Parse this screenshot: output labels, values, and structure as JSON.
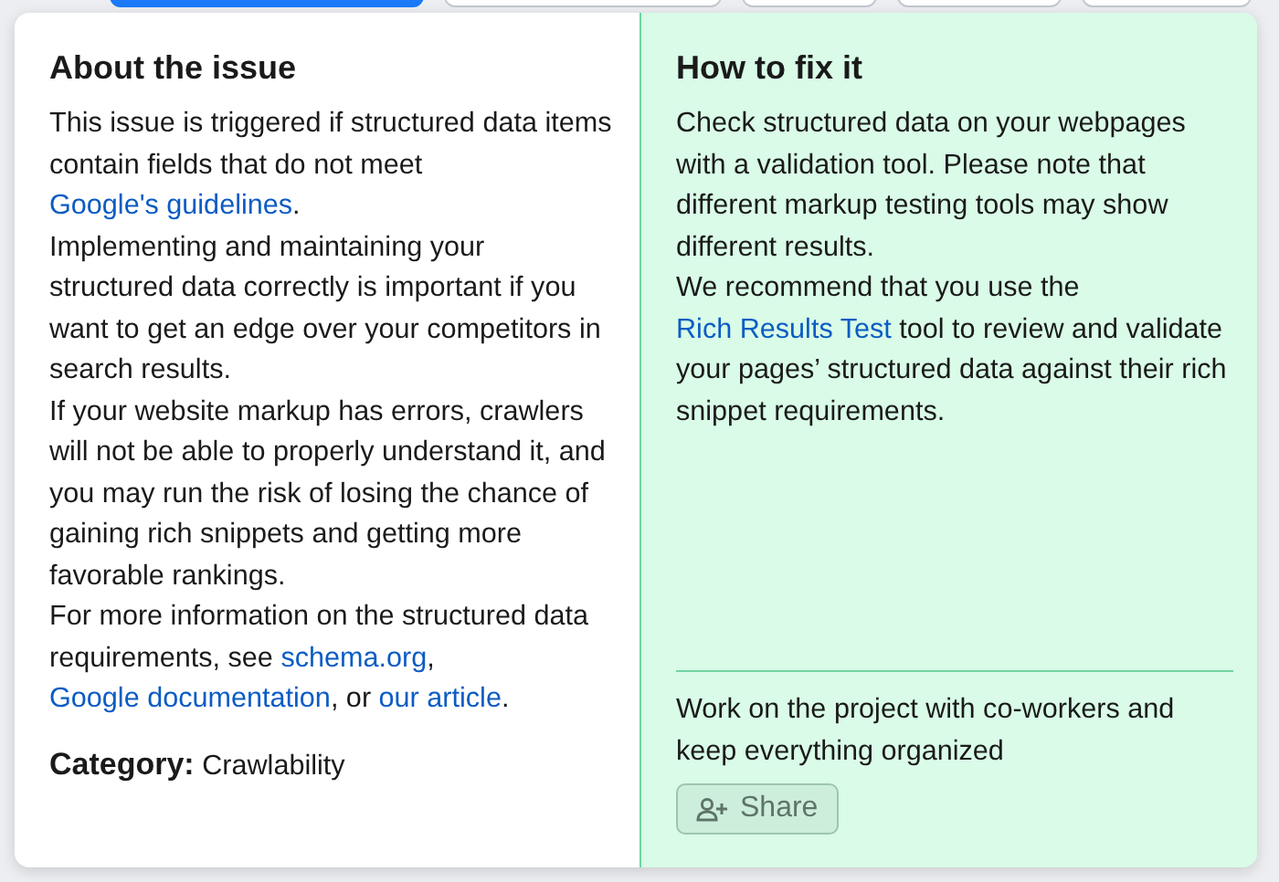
{
  "background_buttons": [
    {
      "selected": true
    },
    {
      "selected": false
    },
    {
      "selected": false
    },
    {
      "selected": false
    },
    {
      "selected": false
    }
  ],
  "about": {
    "title": "About the issue",
    "paragraphs": [
      [
        {
          "kind": "text",
          "text": "This issue is triggered if structured data items contain fields that do not meet "
        },
        {
          "kind": "link",
          "text": "Google's guidelines"
        },
        {
          "kind": "text",
          "text": "."
        }
      ],
      [
        {
          "kind": "text",
          "text": "Implementing and maintaining your structured data correctly is important if you want to get an edge over your competitors in search results."
        }
      ],
      [
        {
          "kind": "text",
          "text": "If your website markup has errors, crawlers will not be able to properly understand it, and you may run the risk of losing the chance of gaining rich snippets and getting more favorable rankings."
        }
      ],
      [
        {
          "kind": "text",
          "text": "For more information on the structured data requirements, see "
        },
        {
          "kind": "link",
          "text": "schema.org"
        },
        {
          "kind": "text",
          "text": ", "
        },
        {
          "kind": "link",
          "text": "Google documentation"
        },
        {
          "kind": "text",
          "text": ", or "
        },
        {
          "kind": "link",
          "text": "our article"
        },
        {
          "kind": "text",
          "text": "."
        }
      ]
    ],
    "category": "**Category:** Crawlability"
  },
  "fix": {
    "title": "How to fix it",
    "paragraphs": [
      [
        {
          "kind": "text",
          "text": "Check structured data on your webpages with a validation tool. Please note that different markup testing tools may show different results."
        }
      ],
      [
        {
          "kind": "text",
          "text": "We recommend that you use the "
        },
        {
          "kind": "link",
          "text": "Rich Results Test"
        },
        {
          "kind": "text",
          "text": " tool to review and validate your pages’ structured data against their rich snippet requirements."
        }
      ]
    ],
    "collaborate": "Work on the project with co-workers and keep everything organized",
    "share_button": {
      "label": "Share",
      "disabled": true
    }
  }
}
